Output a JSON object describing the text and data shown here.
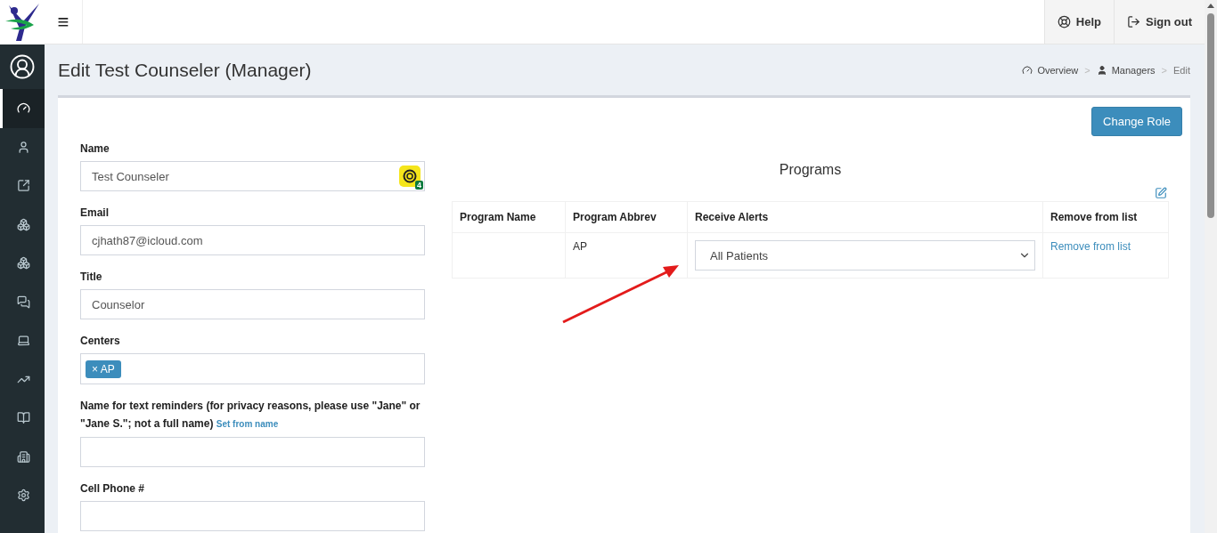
{
  "topbar": {
    "menu_glyph": "≡",
    "buttons": [
      {
        "kind": "help",
        "label": "Help"
      },
      {
        "kind": "signout",
        "label": "Sign out"
      }
    ]
  },
  "sidebar": {
    "items": [
      {
        "selected": true
      },
      {
        "selected": false
      },
      {
        "selected": false
      },
      {
        "selected": false
      },
      {
        "selected": false
      },
      {
        "selected": false
      },
      {
        "selected": false
      },
      {
        "selected": false
      },
      {
        "selected": false
      },
      {
        "selected": false
      },
      {
        "selected": false
      }
    ]
  },
  "page": {
    "title": "Edit Test Counseler (Manager)",
    "breadcrumbs": [
      {
        "kind": "overview",
        "label": "Overview"
      },
      {
        "kind": "managers",
        "label": "Managers"
      },
      {
        "kind": "plain",
        "label": "Edit"
      }
    ],
    "separator": ">"
  },
  "change_role_button": "Change Role",
  "form": {
    "fields": [
      {
        "kind": "text",
        "label": "Name",
        "value": "Test Counseler",
        "badge": "4"
      },
      {
        "kind": "text",
        "label": "Email",
        "value": "cjhath87@icloud.com"
      },
      {
        "kind": "text",
        "label": "Title",
        "value": "Counselor"
      },
      {
        "kind": "tags",
        "label": "Centers",
        "tags": [
          {
            "remove": "×",
            "label": "AP"
          }
        ]
      },
      {
        "kind": "text",
        "label": "Name for text reminders (for privacy reasons, please use \"Jane\" or \"Jane S.\"; not a full name)",
        "link": "Set from name"
      },
      {
        "kind": "text",
        "label": "Cell Phone #"
      }
    ]
  },
  "programs": {
    "title": "Programs",
    "columns": [
      "Program Name",
      "Program Abbrev",
      "Receive Alerts",
      "Remove from list"
    ],
    "rows": [
      {
        "abbrev": "AP",
        "alerts": "All Patients",
        "remove": "Remove from list"
      }
    ]
  }
}
